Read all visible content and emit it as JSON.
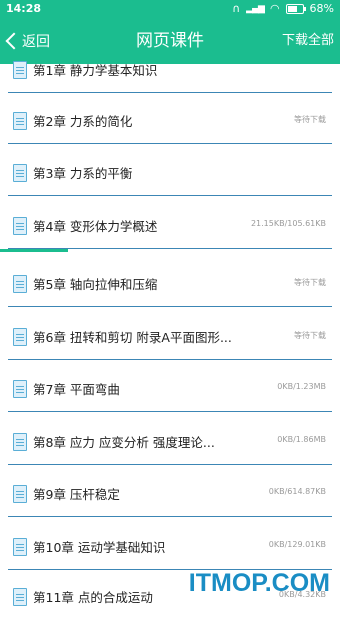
{
  "statusbar": {
    "time": "14:28",
    "battery_percent": "68%"
  },
  "navbar": {
    "back_label": "返回",
    "title": "网页课件",
    "download_all_label": "下载全部"
  },
  "chapters": [
    {
      "name": "第1章 静力学基本知识",
      "status": ""
    },
    {
      "name": "第2章 力系的简化",
      "status": "等待下载"
    },
    {
      "name": "第3章 力系的平衡",
      "status": ""
    },
    {
      "name": "第4章 变形体力学概述",
      "status": "21.15KB/105.61KB",
      "progress": 0.2
    },
    {
      "name": "第5章 轴向拉伸和压缩",
      "status": "等待下载"
    },
    {
      "name": "第6章 扭转和剪切 附录A平面图形...",
      "status": "等待下载"
    },
    {
      "name": "第7章 平面弯曲",
      "status": "0KB/1.23MB"
    },
    {
      "name": "第8章 应力 应变分析 强度理论...",
      "status": "0KB/1.86MB"
    },
    {
      "name": "第9章 压杆稳定",
      "status": "0KB/614.87KB"
    },
    {
      "name": "第10章 运动学基础知识",
      "status": "0KB/129.01KB"
    },
    {
      "name": "第11章 点的合成运动",
      "status": "0KB/4.32KB"
    }
  ],
  "watermark": "ITMOP.COM",
  "colors": {
    "accent": "#1bbd8f",
    "divider": "#3c86b5"
  }
}
